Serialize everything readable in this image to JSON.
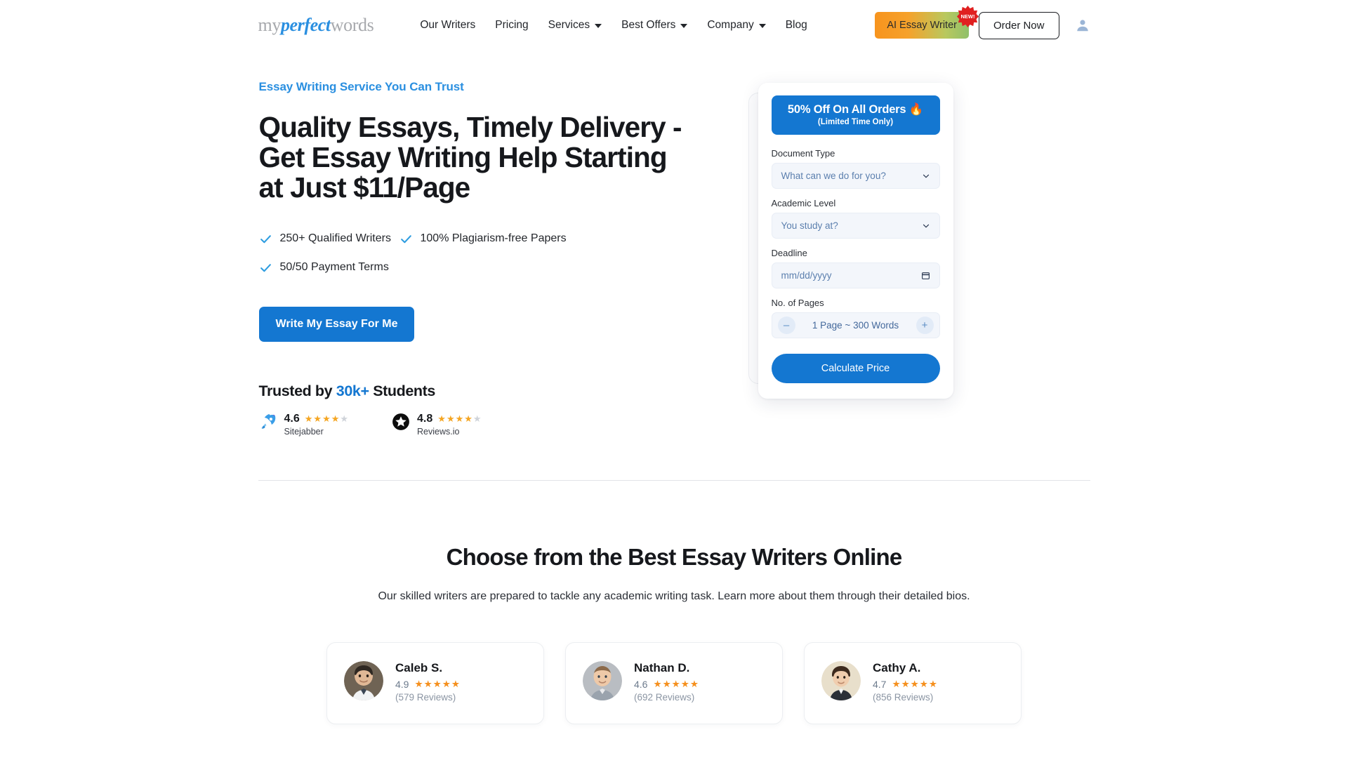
{
  "header": {
    "logo": {
      "part1": "my",
      "part2": "perfect",
      "part3": "words"
    },
    "nav": [
      {
        "label": "Our Writers",
        "has_caret": false
      },
      {
        "label": "Pricing",
        "has_caret": false
      },
      {
        "label": "Services",
        "has_caret": true
      },
      {
        "label": "Best Offers",
        "has_caret": true
      },
      {
        "label": "Company",
        "has_caret": true
      },
      {
        "label": "Blog",
        "has_caret": false
      }
    ],
    "ai_button": "AI Essay Writer",
    "new_badge": "NEW!",
    "order_button": "Order Now",
    "account_icon": "user-icon"
  },
  "hero": {
    "eyebrow": "Essay Writing Service You Can Trust",
    "title": "Quality Essays, Timely Delivery - Get Essay Writing Help Starting at Just $11/Page",
    "features": [
      "250+ Qualified Writers",
      "100% Plagiarism-free Papers",
      "50/50 Payment Terms"
    ],
    "cta": "Write My Essay For Me",
    "trusted_prefix": "Trusted by ",
    "trusted_count": "30k+",
    "trusted_suffix": " Students",
    "ratings": [
      {
        "score": "4.6",
        "name": "Sitejabber",
        "stars_filled": 4,
        "stars_total": 5,
        "icon": "rocket-icon"
      },
      {
        "score": "4.8",
        "name": "Reviews.io",
        "stars_filled": 4,
        "stars_total": 5,
        "icon": "star-circle-icon"
      }
    ]
  },
  "order_form": {
    "promo_main": "50% Off On All Orders 🔥",
    "promo_sub": "(Limited Time Only)",
    "fields": [
      {
        "label": "Document Type",
        "value": "What can we do for you?",
        "control": "select"
      },
      {
        "label": "Academic Level",
        "value": "You study at?",
        "control": "select"
      },
      {
        "label": "Deadline",
        "value": "mm/dd/yyyy",
        "control": "date"
      }
    ],
    "pages_label": "No. of Pages",
    "pages_value": "1 Page ~ 300 Words",
    "minus": "–",
    "plus": "+",
    "submit": "Calculate Price"
  },
  "writers_section": {
    "title": "Choose from the Best Essay Writers Online",
    "subtitle": "Our skilled writers are prepared to tackle any academic writing task. Learn more about them through their detailed bios.",
    "cards": [
      {
        "name": "Caleb S.",
        "score": "4.9",
        "stars": "★★★★★",
        "reviews": "(579 Reviews)",
        "avatar": "avatar-male-dark-hair"
      },
      {
        "name": "Nathan D.",
        "score": "4.6",
        "stars": "★★★★★",
        "reviews": "(692 Reviews)",
        "avatar": "avatar-male-short-hair"
      },
      {
        "name": "Cathy A.",
        "score": "4.7",
        "stars": "★★★★★",
        "reviews": "(856 Reviews)",
        "avatar": "avatar-female-brown-hair"
      }
    ]
  },
  "colors": {
    "brand_blue": "#1477d1",
    "accent_orange": "#f5a623",
    "badge_red": "#e02020",
    "text_dark": "#16181c",
    "field_bg": "#f3f6fb"
  }
}
